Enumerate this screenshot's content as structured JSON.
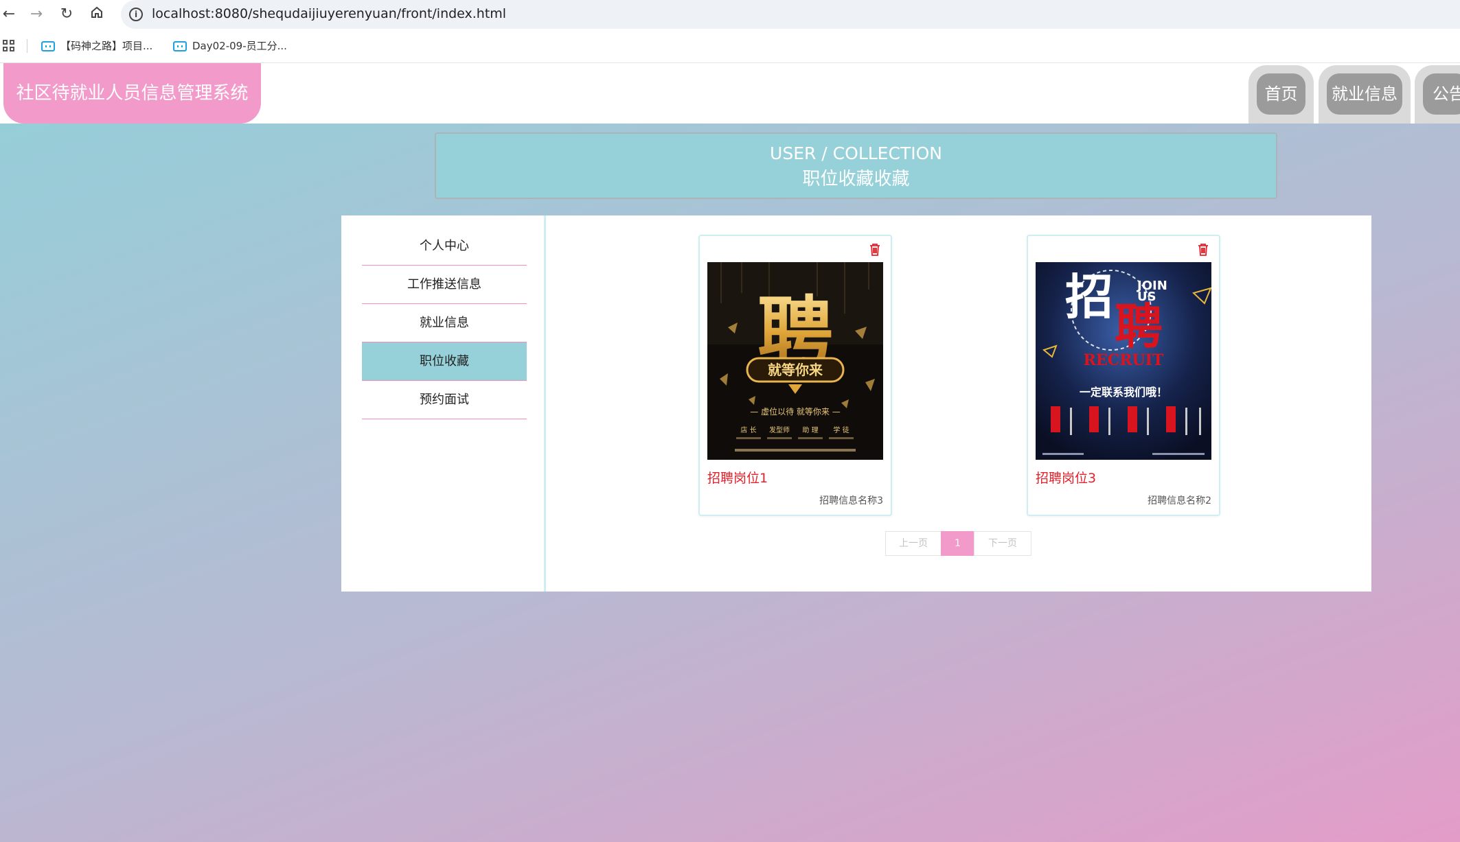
{
  "browser": {
    "url": "localhost:8080/shequdaijiuyerenyuan/front/index.html",
    "bookmarks": [
      {
        "label": "【码神之路】项目..."
      },
      {
        "label": "Day02-09-员工分..."
      }
    ]
  },
  "header": {
    "app_title": "社区待就业人员信息管理系统",
    "nav": [
      {
        "label": "首页"
      },
      {
        "label": "就业信息"
      },
      {
        "label": "公告"
      }
    ]
  },
  "banner": {
    "en": "USER / COLLECTION",
    "zh": "职位收藏收藏"
  },
  "sidebar": {
    "items": [
      {
        "label": "个人中心",
        "active": false
      },
      {
        "label": "工作推送信息",
        "active": false
      },
      {
        "label": "就业信息",
        "active": false
      },
      {
        "label": "职位收藏",
        "active": true
      },
      {
        "label": "预约面试",
        "active": false
      }
    ]
  },
  "collections": [
    {
      "title": "招聘岗位1",
      "subtitle": "招聘信息名称3",
      "poster": {
        "big": "聘",
        "badge": "就等你来",
        "line": "— 虚位以待  就等你来 —",
        "roles": [
          "店 长",
          "发型师",
          "助 理",
          "学 徒"
        ]
      }
    },
    {
      "title": "招聘岗位3",
      "subtitle": "招聘信息名称2",
      "poster": {
        "big1": "招",
        "big2": "聘",
        "join": "JOIN",
        "us": "US",
        "recruit": "RECRUIT",
        "line": "一定联系我们哦！"
      }
    }
  ],
  "pager": {
    "prev": "上一页",
    "current": "1",
    "next": "下一页"
  },
  "colors": {
    "accent_pink": "#f29aca",
    "accent_teal": "#96d1d9",
    "title_red": "#e5202a"
  }
}
